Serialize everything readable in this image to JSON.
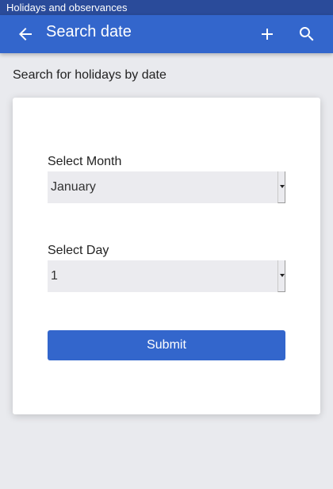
{
  "statusbar": {
    "app_name": "Holidays and observances"
  },
  "appbar": {
    "title": "Search date",
    "icons": {
      "back": "arrow-left-icon",
      "add": "plus-icon",
      "search": "search-icon"
    }
  },
  "page": {
    "subtitle": "Search for holidays by date"
  },
  "form": {
    "month_label": "Select Month",
    "month_value": "January",
    "day_label": "Select Day",
    "day_value": "1",
    "submit_label": "Submit"
  },
  "colors": {
    "primary": "#3366cc",
    "statusbar": "#2a4b9a",
    "background": "#e9eaee"
  }
}
